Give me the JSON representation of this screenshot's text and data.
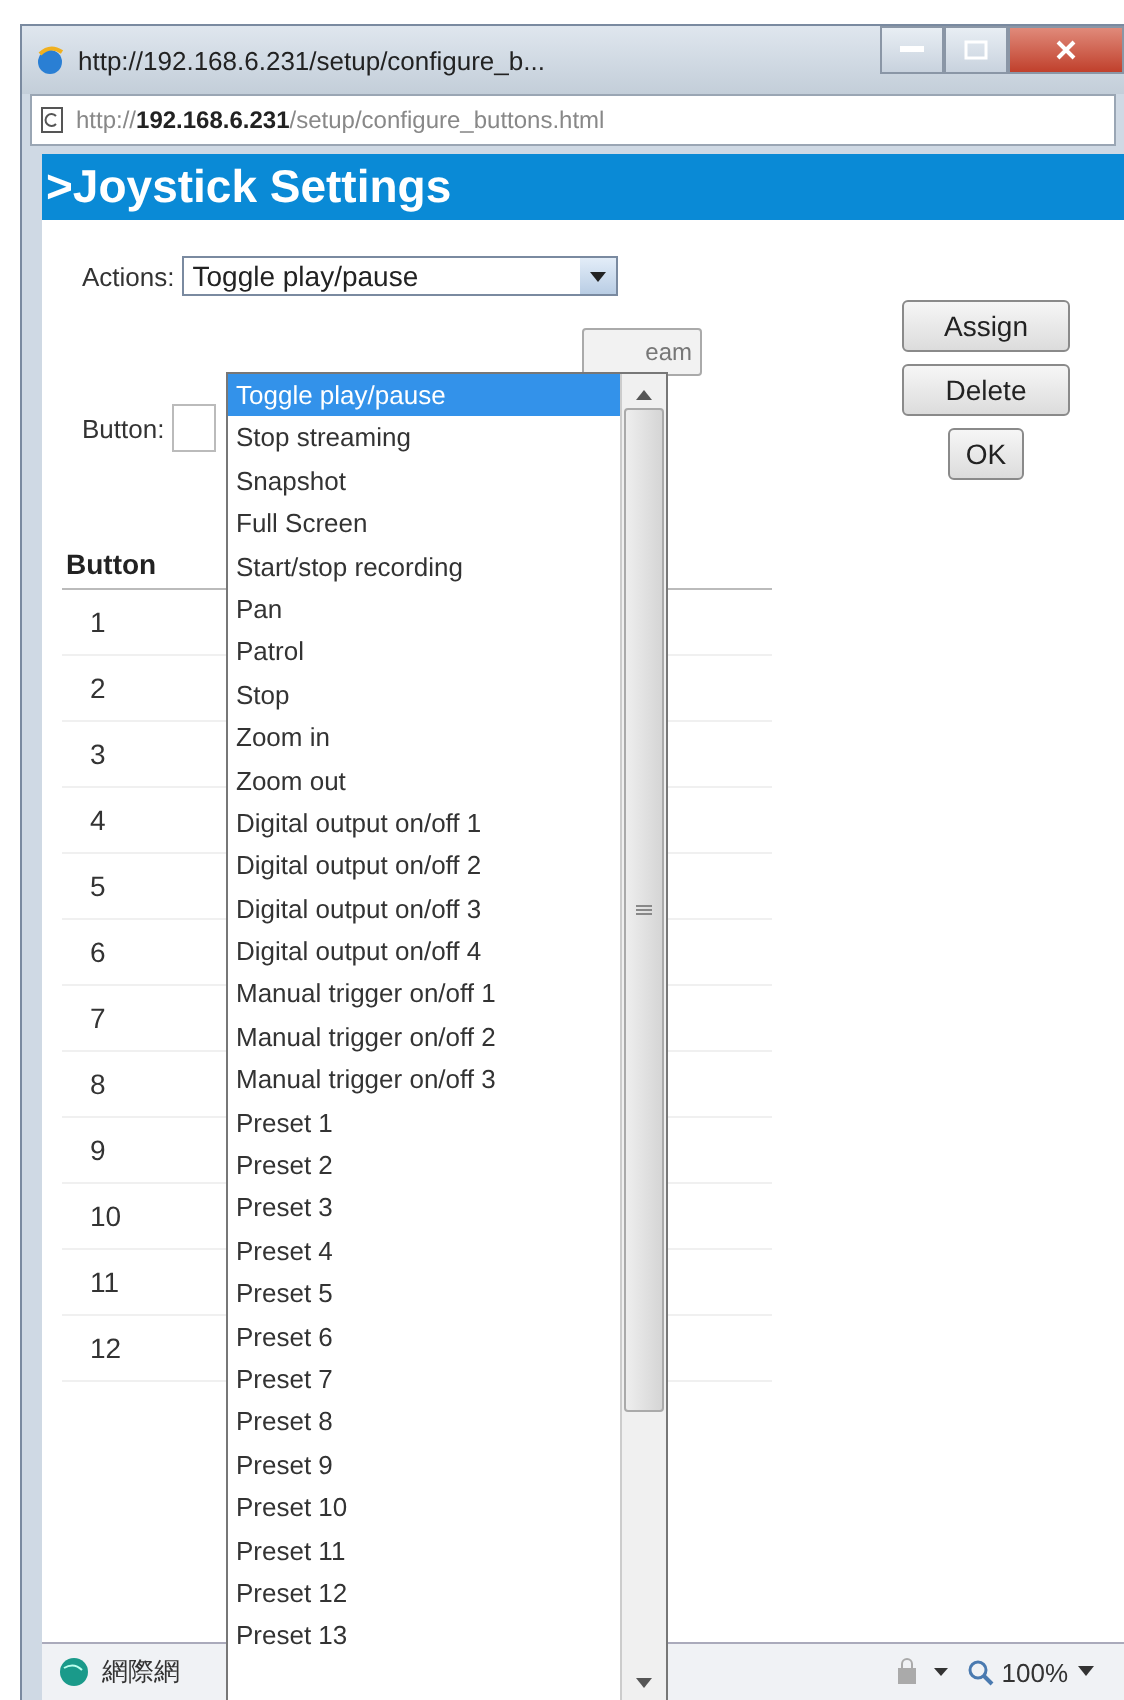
{
  "window": {
    "title": "http://192.168.6.231/setup/configure_b..."
  },
  "address_bar": {
    "url": "http://**192.168.6.231**/setup/configure_buttons.html"
  },
  "page": {
    "heading": ">Joystick Settings"
  },
  "form": {
    "actions_label": "Actions:",
    "actions_value": "Toggle play/pause",
    "button_label": "Button:",
    "hidden_button_text": "eam",
    "buttons": [
      "Assign",
      "Delete",
      "OK"
    ]
  },
  "dropdown_options": [
    {
      "label": "Toggle play/pause",
      "selected": true
    },
    {
      "label": "Stop streaming",
      "selected": false
    },
    {
      "label": "Snapshot",
      "selected": false
    },
    {
      "label": "Full Screen",
      "selected": false
    },
    {
      "label": "Start/stop recording",
      "selected": false
    },
    {
      "label": "Pan",
      "selected": false
    },
    {
      "label": "Patrol",
      "selected": false
    },
    {
      "label": "Stop",
      "selected": false
    },
    {
      "label": "Zoom in",
      "selected": false
    },
    {
      "label": "Zoom out",
      "selected": false
    },
    {
      "label": "Digital output on/off 1",
      "selected": false
    },
    {
      "label": "Digital output on/off 2",
      "selected": false
    },
    {
      "label": "Digital output on/off 3",
      "selected": false
    },
    {
      "label": "Digital output on/off 4",
      "selected": false
    },
    {
      "label": "Manual trigger on/off 1",
      "selected": false
    },
    {
      "label": "Manual trigger on/off 2",
      "selected": false
    },
    {
      "label": "Manual trigger on/off 3",
      "selected": false
    },
    {
      "label": "Preset 1",
      "selected": false
    },
    {
      "label": "Preset 2",
      "selected": false
    },
    {
      "label": "Preset 3",
      "selected": false
    },
    {
      "label": "Preset 4",
      "selected": false
    },
    {
      "label": "Preset 5",
      "selected": false
    },
    {
      "label": "Preset 6",
      "selected": false
    },
    {
      "label": "Preset 7",
      "selected": false
    },
    {
      "label": "Preset 8",
      "selected": false
    },
    {
      "label": "Preset 9",
      "selected": false
    },
    {
      "label": "Preset 10",
      "selected": false
    },
    {
      "label": "Preset 11",
      "selected": false
    },
    {
      "label": "Preset 12",
      "selected": false
    },
    {
      "label": "Preset 13",
      "selected": false
    }
  ],
  "table": {
    "columns": [
      "Button"
    ],
    "rows": [
      "1",
      "2",
      "3",
      "4",
      "5",
      "6",
      "7",
      "8",
      "9",
      "10",
      "11",
      "12"
    ]
  },
  "status_bar": {
    "zone": "網際網",
    "zoom": "100%"
  }
}
